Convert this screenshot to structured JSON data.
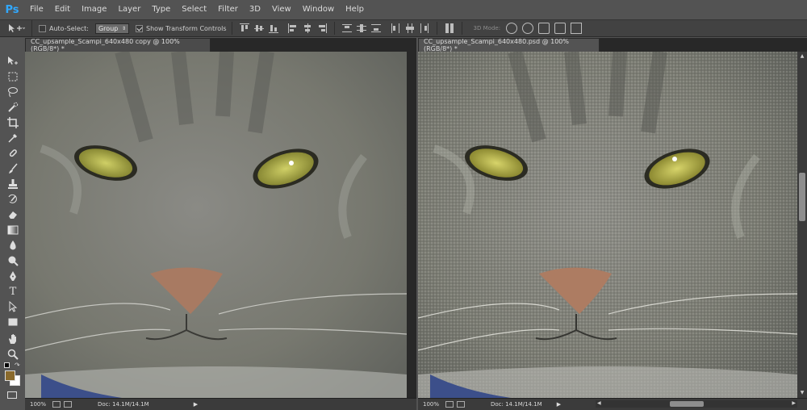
{
  "app": {
    "logo": "Ps",
    "menu": [
      "File",
      "Edit",
      "Image",
      "Layer",
      "Type",
      "Select",
      "Filter",
      "3D",
      "View",
      "Window",
      "Help"
    ]
  },
  "options": {
    "auto_select_label": "Auto-Select:",
    "auto_select_checked": false,
    "group_value": "Group",
    "show_transform_label": "Show Transform Controls",
    "show_transform_checked": true,
    "mode_3d_label": "3D Mode:"
  },
  "tools": [
    "move-tool-icon",
    "marquee-tool-icon",
    "lasso-tool-icon",
    "quick-select-tool-icon",
    "crop-tool-icon",
    "eyedropper-tool-icon",
    "spot-healing-tool-icon",
    "brush-tool-icon",
    "clone-stamp-tool-icon",
    "history-brush-tool-icon",
    "eraser-tool-icon",
    "gradient-tool-icon",
    "blur-tool-icon",
    "dodge-tool-icon",
    "pen-tool-icon",
    "type-tool-icon",
    "path-select-tool-icon",
    "rectangle-tool-icon",
    "hand-tool-icon",
    "zoom-tool-icon"
  ],
  "colors": {
    "foreground": "#8a6a2c",
    "background": "#ffffff",
    "logo": "#31a8ff"
  },
  "documents": [
    {
      "title": "CC_upsample_Scampi_640x480 copy @ 100% (RGB/8*) *",
      "zoom": "100%",
      "doc_size": "Doc: 14.1M/14.1M"
    },
    {
      "title": "CC_upsample_Scampi_640x480.psd @ 100% (RGB/8*) *",
      "zoom": "100%",
      "doc_size": "Doc: 14.1M/14.1M"
    }
  ]
}
